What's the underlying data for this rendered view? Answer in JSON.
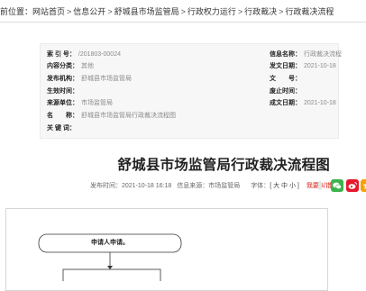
{
  "breadcrumb": {
    "prefix": "前位置：",
    "items": [
      "网站首页",
      "信息公开",
      "舒城县市场监管局",
      "行政权力运行",
      "行政裁决",
      "行政裁决流程"
    ],
    "separator": ">"
  },
  "meta": {
    "index_label": "索 引 号：",
    "index_value": "/201803-00024",
    "category_label": "内容分类：",
    "category_value": "其他",
    "publisher_label": "发布机构：",
    "publisher_value": "舒城县市场监管局",
    "effective_label": "生效时间：",
    "effective_value": "",
    "source_label": "来源单位：",
    "source_value": "市场监管局",
    "name_label": "名　　称：",
    "name_value": "舒城县市场监管局行政裁决流程图",
    "keywords_label": "关 键 词：",
    "keywords_value": "",
    "info_name_label": "信息名称：",
    "info_name_value": "行政裁决流程",
    "publish_date_label": "发文日期：",
    "publish_date_value": "2021-10-18",
    "doc_no_label": "文　　号：",
    "doc_no_value": "",
    "abolish_label": "废止时间：",
    "abolish_value": "",
    "created_label": "成文日期：",
    "created_value": "2021-10-18"
  },
  "article": {
    "title": "舒城县市场监管局行政裁决流程图",
    "publish_time": "发布时间：2021-10-18 16:18",
    "source": "信息来源：市场监管局",
    "font_label": "字体：",
    "font_sizes": "[ 大 中 小 ]",
    "report_error": "我要纠错"
  },
  "share": {
    "icons": [
      "wechat-icon",
      "weibo-icon",
      "qzone-icon"
    ],
    "colors": [
      "#3bb34a",
      "#e6162d",
      "#f7a300"
    ]
  },
  "flowchart": {
    "first_step": "申请人申请。"
  }
}
